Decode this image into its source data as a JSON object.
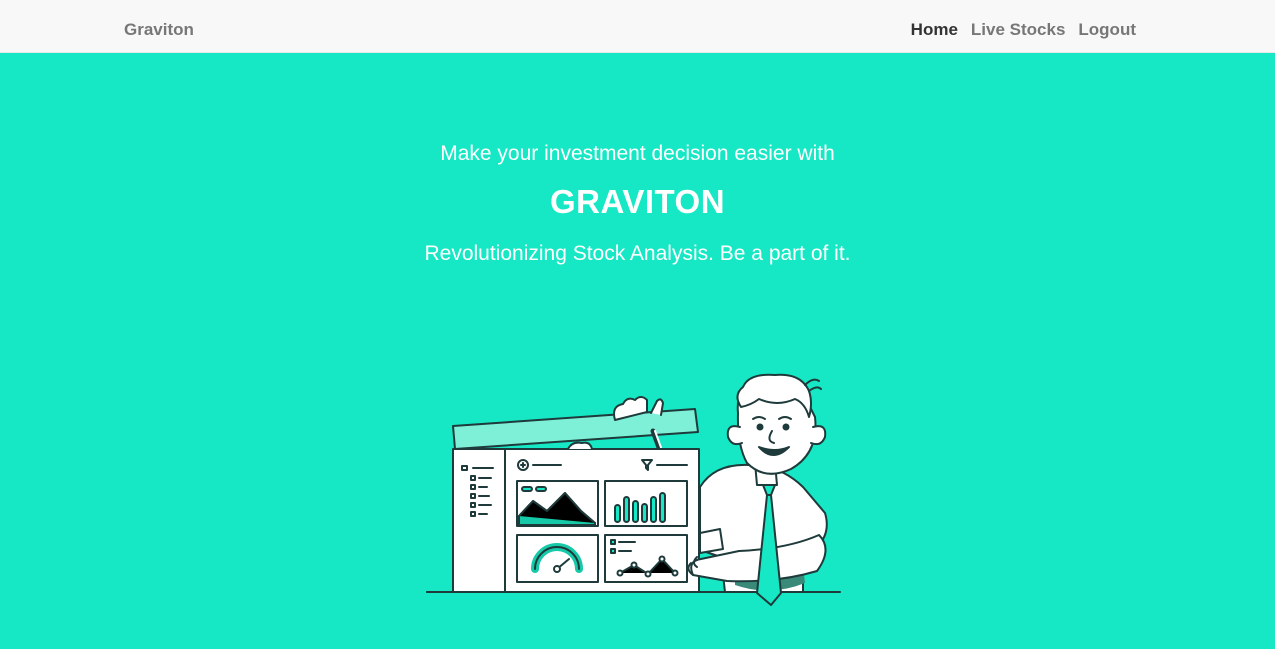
{
  "navbar": {
    "brand": "Graviton",
    "links": [
      {
        "label": "Home",
        "active": true
      },
      {
        "label": "Live Stocks",
        "active": false
      },
      {
        "label": "Logout",
        "active": false
      }
    ]
  },
  "hero": {
    "tagline": "Make your investment decision easier with",
    "headline": "GRAVITON",
    "subline": "Revolutionizing Stock Analysis. Be a part of it.",
    "background_color": "#16e8c5",
    "illustration": "man-presenting-dashboard-illustration"
  }
}
